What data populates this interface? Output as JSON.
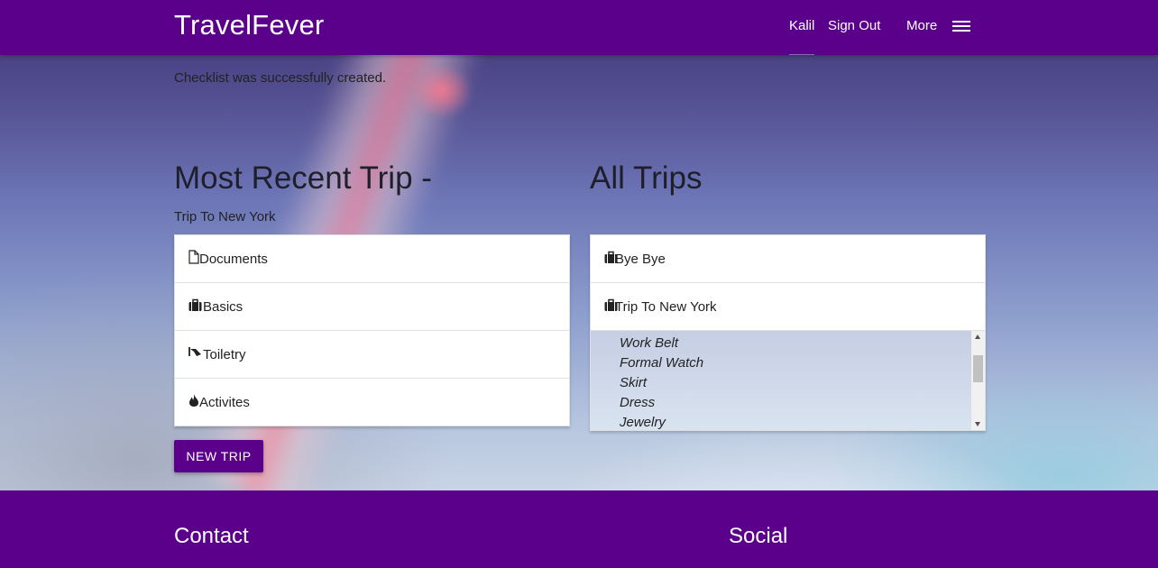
{
  "header": {
    "brand": "TravelFever",
    "user": "Kalil",
    "sign_out": "Sign Out",
    "more": "More",
    "menu_icon": "hamburger-menu-icon"
  },
  "flash": "Checklist was successfully created.",
  "recent": {
    "title": "Most Recent Trip -",
    "trip_name": "Trip To New York",
    "items": [
      {
        "label": "Documents",
        "icon": "document-icon"
      },
      {
        "label": "Basics",
        "icon": "briefcase-icon"
      },
      {
        "label": "Toiletry",
        "icon": "brush-icon"
      },
      {
        "label": "Activites",
        "icon": "fire-icon"
      }
    ],
    "new_trip_label": "New Trip"
  },
  "all_trips": {
    "title": "All Trips",
    "trips": [
      {
        "label": "Bye Bye",
        "icon": "briefcase-icon"
      },
      {
        "label": "Trip To New York",
        "icon": "briefcase-icon"
      }
    ],
    "checklist": [
      "Work Belt",
      "Formal Watch",
      "Skirt",
      "Dress",
      "Jewelry"
    ]
  },
  "footer": {
    "contact_title": "Contact",
    "social_title": "Social"
  },
  "colors": {
    "primary": "#5b008b",
    "text": "#212121"
  }
}
